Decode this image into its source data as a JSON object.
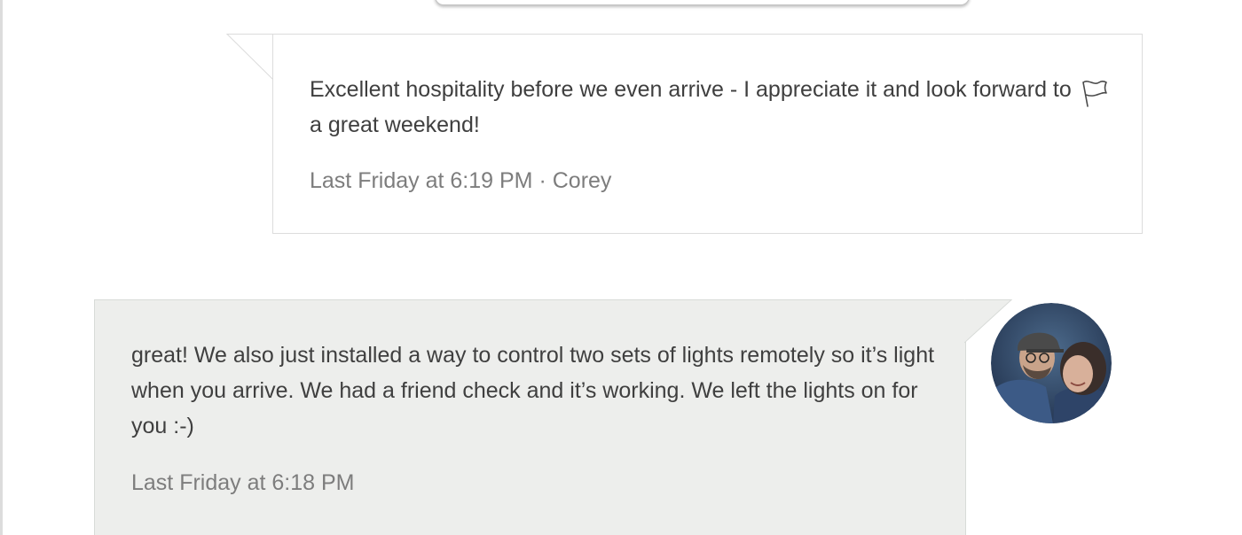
{
  "conversation": {
    "messages": [
      {
        "text": "Excellent hospitality before we even arrive - I appreciate it and look forward to a great weekend!",
        "timestamp": "Last Friday at 6:19 PM",
        "separator": "·",
        "author": "Corey",
        "flag_icon": "flag-icon"
      },
      {
        "text": "great! We also just installed a way to control two sets of lights remotely so it’s light when you arrive. We had a friend check and it’s working. We left the lights on for you :-)",
        "timestamp": "Last Friday at 6:18 PM",
        "avatar_icon": "user-avatar"
      }
    ]
  },
  "colors": {
    "received_bg": "#ffffff",
    "sent_bg": "#edeeec",
    "border": "#dcdcdc",
    "text": "#3f3f3f",
    "meta_text": "#7d7d7d"
  }
}
